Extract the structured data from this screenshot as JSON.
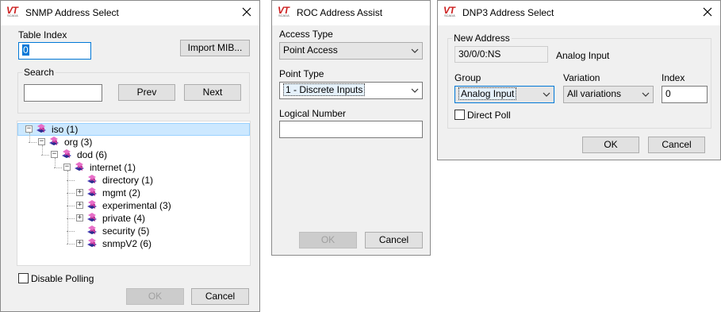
{
  "snmp": {
    "title": "SNMP Address Select",
    "table_index_label": "Table Index",
    "table_index_value": "0",
    "import_mib_label": "Import MIB...",
    "search_label": "Search",
    "search_value": "",
    "prev_label": "Prev",
    "next_label": "Next",
    "tree": [
      {
        "label": "iso (1)",
        "expander": "−",
        "selected": true
      },
      {
        "label": "org (3)",
        "expander": "−"
      },
      {
        "label": "dod (6)",
        "expander": "−"
      },
      {
        "label": "internet (1)",
        "expander": "−"
      },
      {
        "label": "directory (1)",
        "expander": ""
      },
      {
        "label": "mgmt (2)",
        "expander": "+"
      },
      {
        "label": "experimental (3)",
        "expander": "+"
      },
      {
        "label": "private (4)",
        "expander": "+"
      },
      {
        "label": "security (5)",
        "expander": ""
      },
      {
        "label": "snmpV2 (6)",
        "expander": "+"
      }
    ],
    "disable_polling_label": "Disable Polling",
    "ok_label": "OK",
    "cancel_label": "Cancel"
  },
  "roc": {
    "title": "ROC Address Assist",
    "access_type_label": "Access Type",
    "access_type_value": "Point Access",
    "point_type_label": "Point Type",
    "point_type_value": "1 - Discrete Inputs",
    "logical_number_label": "Logical Number",
    "logical_number_value": "",
    "ok_label": "OK",
    "cancel_label": "Cancel"
  },
  "dnp3": {
    "title": "DNP3 Address Select",
    "new_address_label": "New Address",
    "new_address_value": "30/0/0:NS",
    "address_type": "Analog Input",
    "group_label": "Group",
    "group_value": "Analog Input",
    "variation_label": "Variation",
    "variation_value": "All variations",
    "index_label": "Index",
    "index_value": "0",
    "direct_poll_label": "Direct Poll",
    "ok_label": "OK",
    "cancel_label": "Cancel"
  },
  "logo": {
    "brand": "VT",
    "sub": "SCADA"
  },
  "colors": {
    "logo_red": "#cc1f1f",
    "selection": "#cce8ff",
    "accent": "#0078d7"
  }
}
